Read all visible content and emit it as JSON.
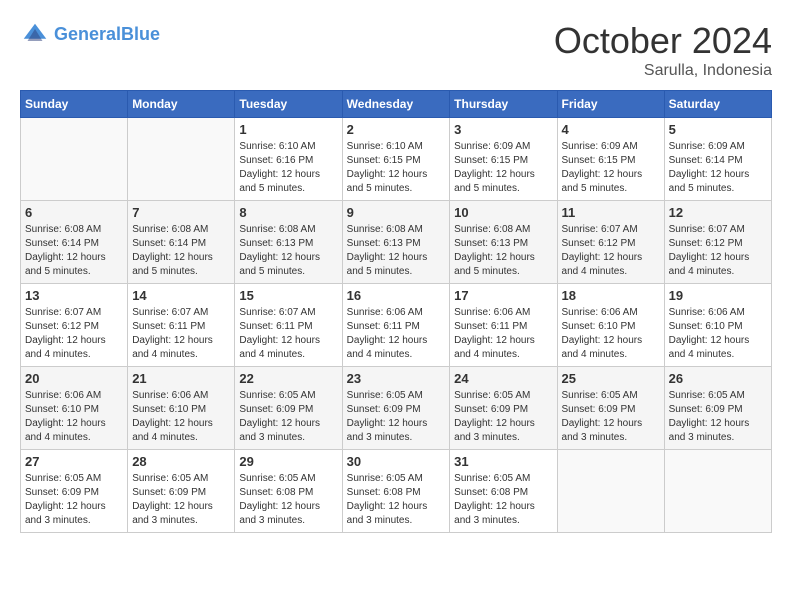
{
  "header": {
    "logo_line1": "General",
    "logo_line2": "Blue",
    "month": "October 2024",
    "location": "Sarulla, Indonesia"
  },
  "days_of_week": [
    "Sunday",
    "Monday",
    "Tuesday",
    "Wednesday",
    "Thursday",
    "Friday",
    "Saturday"
  ],
  "weeks": [
    [
      {
        "day": "",
        "info": ""
      },
      {
        "day": "",
        "info": ""
      },
      {
        "day": "1",
        "info": "Sunrise: 6:10 AM\nSunset: 6:16 PM\nDaylight: 12 hours and 5 minutes."
      },
      {
        "day": "2",
        "info": "Sunrise: 6:10 AM\nSunset: 6:15 PM\nDaylight: 12 hours and 5 minutes."
      },
      {
        "day": "3",
        "info": "Sunrise: 6:09 AM\nSunset: 6:15 PM\nDaylight: 12 hours and 5 minutes."
      },
      {
        "day": "4",
        "info": "Sunrise: 6:09 AM\nSunset: 6:15 PM\nDaylight: 12 hours and 5 minutes."
      },
      {
        "day": "5",
        "info": "Sunrise: 6:09 AM\nSunset: 6:14 PM\nDaylight: 12 hours and 5 minutes."
      }
    ],
    [
      {
        "day": "6",
        "info": "Sunrise: 6:08 AM\nSunset: 6:14 PM\nDaylight: 12 hours and 5 minutes."
      },
      {
        "day": "7",
        "info": "Sunrise: 6:08 AM\nSunset: 6:14 PM\nDaylight: 12 hours and 5 minutes."
      },
      {
        "day": "8",
        "info": "Sunrise: 6:08 AM\nSunset: 6:13 PM\nDaylight: 12 hours and 5 minutes."
      },
      {
        "day": "9",
        "info": "Sunrise: 6:08 AM\nSunset: 6:13 PM\nDaylight: 12 hours and 5 minutes."
      },
      {
        "day": "10",
        "info": "Sunrise: 6:08 AM\nSunset: 6:13 PM\nDaylight: 12 hours and 5 minutes."
      },
      {
        "day": "11",
        "info": "Sunrise: 6:07 AM\nSunset: 6:12 PM\nDaylight: 12 hours and 4 minutes."
      },
      {
        "day": "12",
        "info": "Sunrise: 6:07 AM\nSunset: 6:12 PM\nDaylight: 12 hours and 4 minutes."
      }
    ],
    [
      {
        "day": "13",
        "info": "Sunrise: 6:07 AM\nSunset: 6:12 PM\nDaylight: 12 hours and 4 minutes."
      },
      {
        "day": "14",
        "info": "Sunrise: 6:07 AM\nSunset: 6:11 PM\nDaylight: 12 hours and 4 minutes."
      },
      {
        "day": "15",
        "info": "Sunrise: 6:07 AM\nSunset: 6:11 PM\nDaylight: 12 hours and 4 minutes."
      },
      {
        "day": "16",
        "info": "Sunrise: 6:06 AM\nSunset: 6:11 PM\nDaylight: 12 hours and 4 minutes."
      },
      {
        "day": "17",
        "info": "Sunrise: 6:06 AM\nSunset: 6:11 PM\nDaylight: 12 hours and 4 minutes."
      },
      {
        "day": "18",
        "info": "Sunrise: 6:06 AM\nSunset: 6:10 PM\nDaylight: 12 hours and 4 minutes."
      },
      {
        "day": "19",
        "info": "Sunrise: 6:06 AM\nSunset: 6:10 PM\nDaylight: 12 hours and 4 minutes."
      }
    ],
    [
      {
        "day": "20",
        "info": "Sunrise: 6:06 AM\nSunset: 6:10 PM\nDaylight: 12 hours and 4 minutes."
      },
      {
        "day": "21",
        "info": "Sunrise: 6:06 AM\nSunset: 6:10 PM\nDaylight: 12 hours and 4 minutes."
      },
      {
        "day": "22",
        "info": "Sunrise: 6:05 AM\nSunset: 6:09 PM\nDaylight: 12 hours and 3 minutes."
      },
      {
        "day": "23",
        "info": "Sunrise: 6:05 AM\nSunset: 6:09 PM\nDaylight: 12 hours and 3 minutes."
      },
      {
        "day": "24",
        "info": "Sunrise: 6:05 AM\nSunset: 6:09 PM\nDaylight: 12 hours and 3 minutes."
      },
      {
        "day": "25",
        "info": "Sunrise: 6:05 AM\nSunset: 6:09 PM\nDaylight: 12 hours and 3 minutes."
      },
      {
        "day": "26",
        "info": "Sunrise: 6:05 AM\nSunset: 6:09 PM\nDaylight: 12 hours and 3 minutes."
      }
    ],
    [
      {
        "day": "27",
        "info": "Sunrise: 6:05 AM\nSunset: 6:09 PM\nDaylight: 12 hours and 3 minutes."
      },
      {
        "day": "28",
        "info": "Sunrise: 6:05 AM\nSunset: 6:09 PM\nDaylight: 12 hours and 3 minutes."
      },
      {
        "day": "29",
        "info": "Sunrise: 6:05 AM\nSunset: 6:08 PM\nDaylight: 12 hours and 3 minutes."
      },
      {
        "day": "30",
        "info": "Sunrise: 6:05 AM\nSunset: 6:08 PM\nDaylight: 12 hours and 3 minutes."
      },
      {
        "day": "31",
        "info": "Sunrise: 6:05 AM\nSunset: 6:08 PM\nDaylight: 12 hours and 3 minutes."
      },
      {
        "day": "",
        "info": ""
      },
      {
        "day": "",
        "info": ""
      }
    ]
  ]
}
